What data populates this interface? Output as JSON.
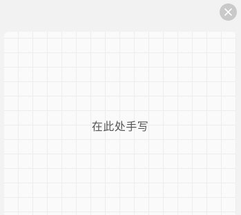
{
  "close": {
    "icon": "close-icon"
  },
  "handwriting_pad": {
    "hint": "在此处手写"
  }
}
